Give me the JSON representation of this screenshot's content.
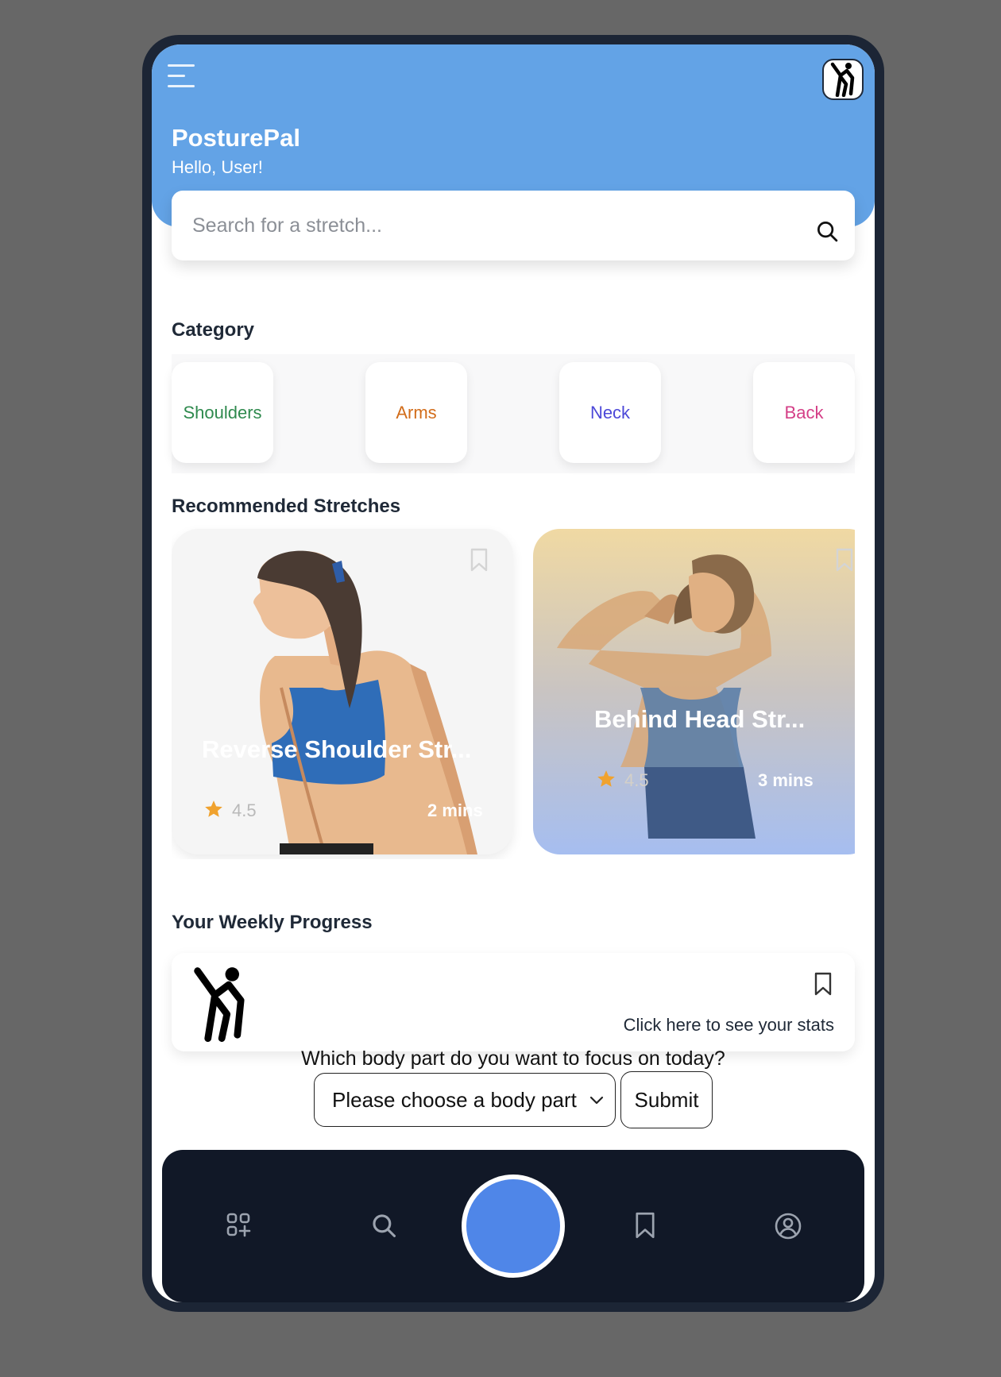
{
  "app": {
    "title": "PosturePal",
    "greeting": "Hello, User!",
    "header_color": "#63a3e6"
  },
  "search": {
    "placeholder": "Search for a stretch..."
  },
  "category": {
    "title": "Category",
    "items": [
      {
        "label": "Shoulders",
        "color": "#2f8a4e"
      },
      {
        "label": "Arms",
        "color": "#d26d1b"
      },
      {
        "label": "Neck",
        "color": "#4c48d8"
      },
      {
        "label": "Back",
        "color": "#d43f87"
      }
    ]
  },
  "recommended": {
    "title": "Recommended Stretches",
    "cards": [
      {
        "title": "Reverse Shoulder Str...",
        "rating": "4.5",
        "duration": "2 mins"
      },
      {
        "title": "Behind Head Str...",
        "rating": "4.5",
        "duration": "3 mins"
      }
    ]
  },
  "progress": {
    "title": "Your Weekly Progress",
    "link_text": "Click here to see your stats"
  },
  "focus": {
    "question": "Which body part do you want to focus on today?",
    "select_value": "Please choose a body part",
    "submit_label": "Submit"
  },
  "nav": {
    "items": [
      "grid-plus-icon",
      "search-icon",
      "center-action-button",
      "bookmark-icon",
      "profile-icon"
    ],
    "accent": "#4f86e8",
    "background": "#111827"
  }
}
